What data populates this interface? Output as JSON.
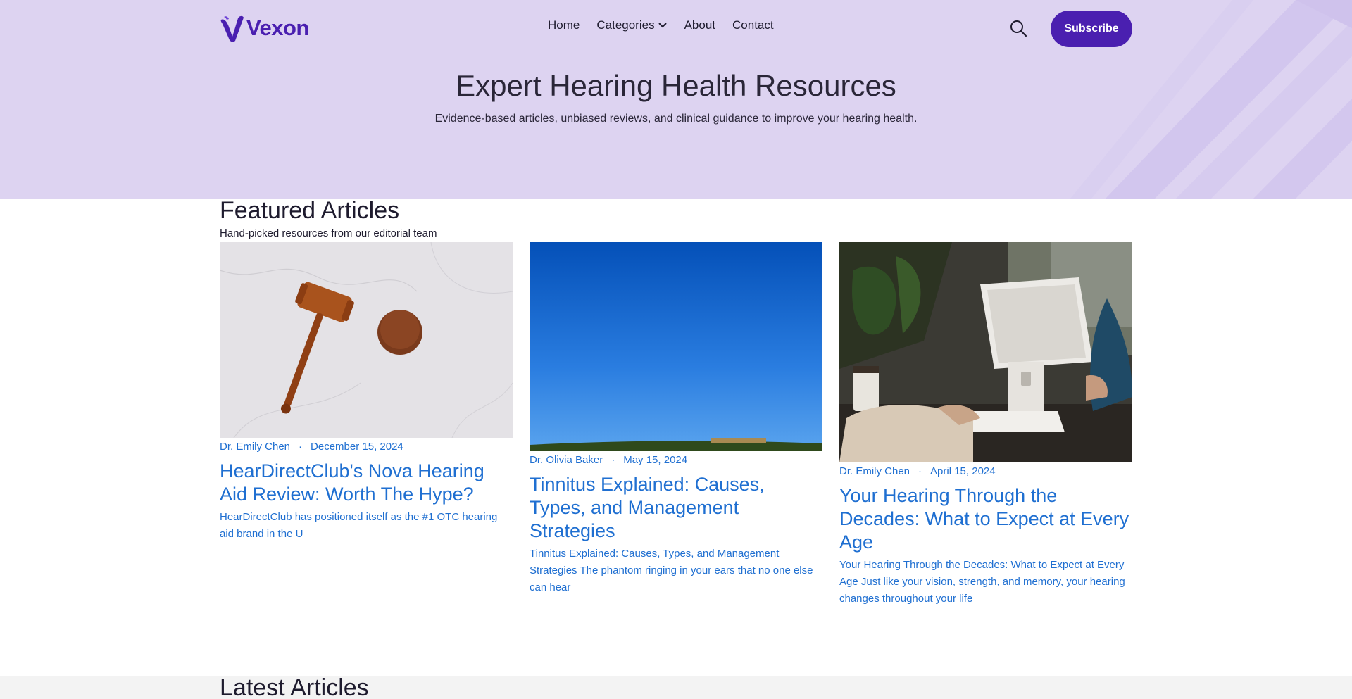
{
  "brand": {
    "name": "Vexon",
    "color": "#4a1fb0"
  },
  "nav": {
    "items": [
      {
        "label": "Home"
      },
      {
        "label": "Categories"
      },
      {
        "label": "About"
      },
      {
        "label": "Contact"
      }
    ],
    "search_icon": "search-icon",
    "subscribe_label": "Subscribe"
  },
  "hero": {
    "title": "Expert Hearing Health Resources",
    "subtitle": "Evidence-based articles, unbiased reviews, and clinical guidance to improve your hearing health.",
    "background": "#ddd3f1"
  },
  "featured": {
    "title": "Featured Articles",
    "subtitle": "Hand-picked resources from our editorial team",
    "articles": [
      {
        "author": "Dr. Emily Chen",
        "date": "December 15, 2024",
        "title": "HearDirectClub's Nova Hearing Aid Review: Worth The Hype?",
        "excerpt": "HearDirectClub has positioned itself as the #1 OTC hearing aid brand in the U"
      },
      {
        "author": "Dr. Olivia Baker",
        "date": "May 15, 2024",
        "title": "Tinnitus Explained: Causes, Types, and Management Strategies",
        "excerpt": "Tinnitus Explained: Causes, Types, and Management Strategies The phantom ringing in your ears that no one else can hear"
      },
      {
        "author": "Dr. Emily Chen",
        "date": "April 15, 2024",
        "title": "Your Hearing Through the Decades: What to Expect at Every Age",
        "excerpt": "Your Hearing Through the Decades: What to Expect at Every Age Just like your vision, strength, and memory, your hearing changes throughout your life"
      }
    ]
  },
  "latest": {
    "title": "Latest Articles"
  },
  "colors": {
    "link": "#1f6fd1",
    "accent": "#4a1fb0"
  }
}
